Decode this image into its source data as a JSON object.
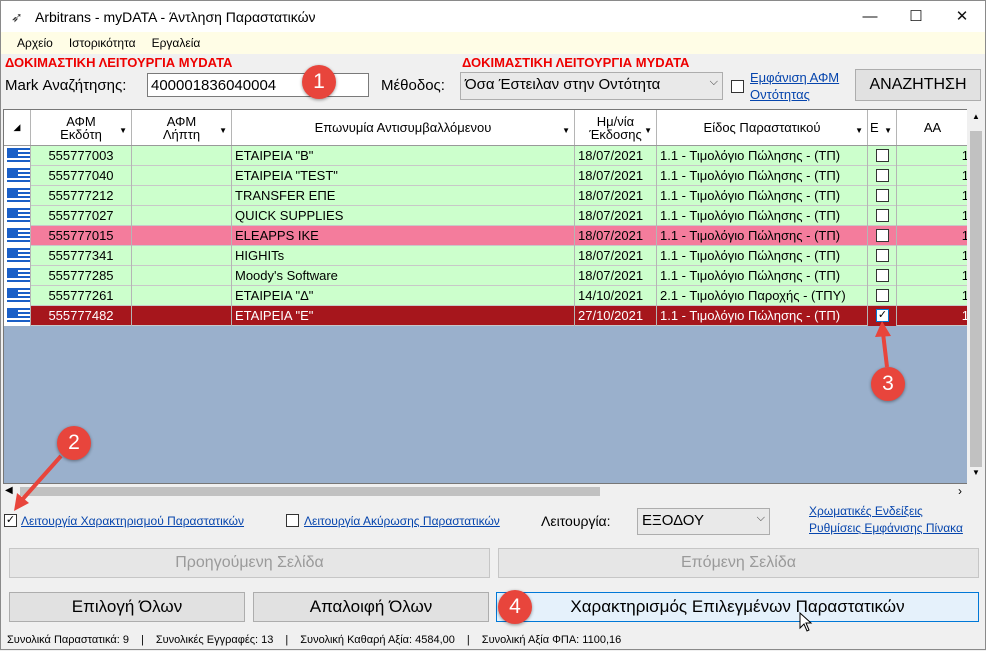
{
  "window": {
    "title": "Arbitrans - myDATA - Άντληση Παραστατικών",
    "minimize": "—",
    "maximize": "☐",
    "close": "✕"
  },
  "menu": [
    "Αρχείο",
    "Ιστορικότητα",
    "Εργαλεία"
  ],
  "warning": "ΔΟΚΙΜΑΣΤΙΚΗ ΛΕΙΤΟΥΡΓΙΑ MYDATA",
  "search": {
    "mark_label": "Mark Αναζήτησης:",
    "mark_value": "400001836040004",
    "method_label": "Μέθοδος:",
    "method_value": "Όσα Έστειλαν στην Οντότητα",
    "show_afm_line1": "Εμφάνιση ΑΦΜ",
    "show_afm_line2": "Οντότητας",
    "search_button": "ΑΝΑΖΗΤΗΣΗ"
  },
  "badges": [
    "1",
    "2",
    "3",
    "4"
  ],
  "table": {
    "headers": {
      "afm_issuer": [
        "ΑΦΜ",
        "Εκδότη"
      ],
      "afm_receiver": [
        "ΑΦΜ",
        "Λήπτη"
      ],
      "name": "Επωνυμία Αντισυμβαλλόμενου",
      "date": [
        "Ημ/νία",
        "Έκδοσης"
      ],
      "type": "Είδος Παραστατικού",
      "e": "Ε",
      "aa": "ΑΑ"
    },
    "rows": [
      {
        "afm": "555777003",
        "name": "ΕΤΑΙΡΕΙΑ \"Β\"",
        "date": "18/07/2021",
        "type": "1.1 - Τιμολόγιο Πώλησης - (ΤΠ)",
        "checked": false,
        "aa": "1",
        "color": "#ccffcc"
      },
      {
        "afm": "555777040",
        "name": "ΕΤΑΙΡΕΙΑ \"TEST\"",
        "date": "18/07/2021",
        "type": "1.1 - Τιμολόγιο Πώλησης - (ΤΠ)",
        "checked": false,
        "aa": "1",
        "color": "#ccffcc"
      },
      {
        "afm": "555777212",
        "name": "TRANSFER ΕΠΕ",
        "date": "18/07/2021",
        "type": "1.1 - Τιμολόγιο Πώλησης - (ΤΠ)",
        "checked": false,
        "aa": "1",
        "color": "#ccffcc"
      },
      {
        "afm": "555777027",
        "name": "QUICK SUPPLIES",
        "date": "18/07/2021",
        "type": "1.1 - Τιμολόγιο Πώλησης - (ΤΠ)",
        "checked": false,
        "aa": "1",
        "color": "#ccffcc"
      },
      {
        "afm": "555777015",
        "name": "ELEAPPS IKE",
        "date": "18/07/2021",
        "type": "1.1 - Τιμολόγιο Πώλησης - (ΤΠ)",
        "checked": false,
        "aa": "1",
        "color": "#f47c9c"
      },
      {
        "afm": "555777341",
        "name": "HIGHITs",
        "date": "18/07/2021",
        "type": "1.1 - Τιμολόγιο Πώλησης - (ΤΠ)",
        "checked": false,
        "aa": "1",
        "color": "#ccffcc"
      },
      {
        "afm": "555777285",
        "name": "Moody's Software",
        "date": "18/07/2021",
        "type": "1.1 - Τιμολόγιο Πώλησης - (ΤΠ)",
        "checked": false,
        "aa": "1",
        "color": "#ccffcc"
      },
      {
        "afm": "555777261",
        "name": "ΕΤΑΙΡΕΙΑ \"Δ\"",
        "date": "14/10/2021",
        "type": "2.1 - Τιμολόγιο Παροχής - (ΤΠΥ)",
        "checked": false,
        "aa": "1",
        "color": "#ccffcc"
      },
      {
        "afm": "555777482",
        "name": "ΕΤΑΙΡΕΙΑ \"Ε\"",
        "date": "27/10/2021",
        "type": "1.1 - Τιμολόγιο Πώλησης - (ΤΠ)",
        "checked": true,
        "aa": "1",
        "color": "#a6161c"
      }
    ]
  },
  "options": {
    "characterization_label": "Λειτουργία Χαρακτηρισμού Παραστατικών",
    "cancellation_label": "Λειτουργία Ακύρωσης Παραστατικών",
    "mode_label": "Λειτουργία:",
    "mode_value": "ΕΞΟΔΟΥ",
    "color_legend_link": "Χρωματικές Ενδείξεις",
    "display_settings_link": "Ρυθμίσεις Εμφάνισης Πίνακα"
  },
  "buttons": {
    "prev_page": "Προηγούμενη Σελίδα",
    "next_page": "Επόμενη Σελίδα",
    "select_all": "Επιλογή Όλων",
    "clear_all": "Απαλοιφή Όλων",
    "characterize": "Χαρακτηρισμός Επιλεγμένων Παραστατικών"
  },
  "status": {
    "total_docs": "Συνολικά Παραστατικά:  9",
    "total_entries": "Συνολικές Εγγραφές:  13",
    "net_value": "Συνολική Καθαρή Αξία:  4584,00",
    "vat_value": "Συνολική Αξία ΦΠΑ:  1100,16",
    "sep": "|"
  }
}
